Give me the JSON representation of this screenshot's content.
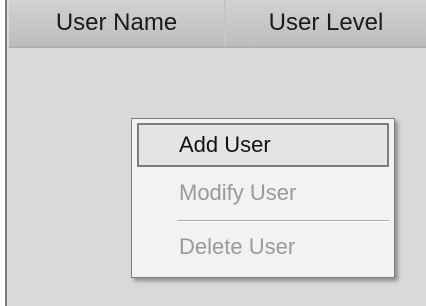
{
  "table": {
    "columns": [
      {
        "label": "User Name"
      },
      {
        "label": "User Level"
      }
    ]
  },
  "context_menu": {
    "items": [
      {
        "label": "Add User",
        "enabled": true,
        "highlighted": true
      },
      {
        "label": "Modify User",
        "enabled": false
      },
      {
        "label": "Delete User",
        "enabled": false
      }
    ]
  },
  "colors": {
    "panel_background": "#d9d9d9",
    "menu_background": "#f2f2f2",
    "disabled_text": "#9a9a9a"
  }
}
